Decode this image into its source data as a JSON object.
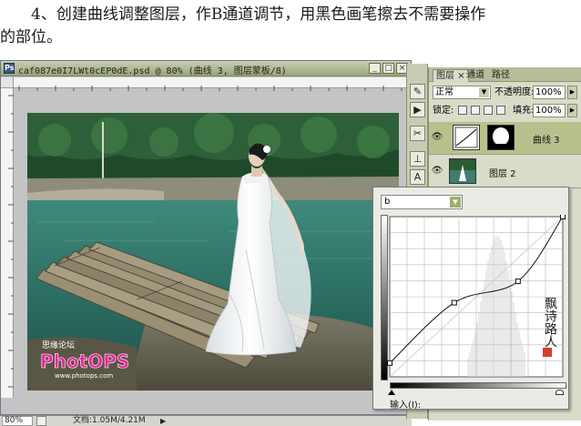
{
  "instruction": {
    "line1": "4、创建曲线调整图层，作B通道调节，用黑色画笔擦去不需要操作",
    "line2": "的部位。"
  },
  "document": {
    "title": "caf087e0I7LWt0cEP0dE.psd @ 80% (曲线 3, 图层蒙板/8)",
    "zoom": "80%",
    "doc_info": "文档:1.05M/4.21M",
    "status_arrow": "▶",
    "window_buttons": [
      "_",
      "□",
      "×"
    ],
    "watermark": {
      "line1": "思缘论坛",
      "brand": "PhotOPS",
      "url": "www.photops.com"
    }
  },
  "tools": {
    "icons": [
      "brush-icon",
      "play-icon",
      "scissors-icon",
      "stamp-icon",
      "text-icon"
    ]
  },
  "layers_panel": {
    "tabs": [
      "图层",
      "通道",
      "路径"
    ],
    "tab_close": "×",
    "blend_mode": "正常",
    "opacity_label": "不透明度:",
    "opacity_value": "100%",
    "lock_label": "锁定:",
    "fill_label": "填充:",
    "fill_value": "100%",
    "layers": [
      {
        "name": "曲线 3",
        "selected": true
      },
      {
        "name": "图层 2",
        "selected": false
      }
    ]
  },
  "curves_dialog": {
    "channel": "b",
    "input_label": "输入(I):",
    "points": [
      {
        "input": 0,
        "output": 22
      },
      {
        "input": 95,
        "output": 118
      },
      {
        "input": 189,
        "output": 152
      },
      {
        "input": 255,
        "output": 255
      }
    ],
    "watermark_text": "飘诗路人"
  },
  "colors": {
    "panel_bg": "#d8dcc8",
    "selected_layer": "#b8c18e",
    "titlebar": "#9aa47c"
  }
}
